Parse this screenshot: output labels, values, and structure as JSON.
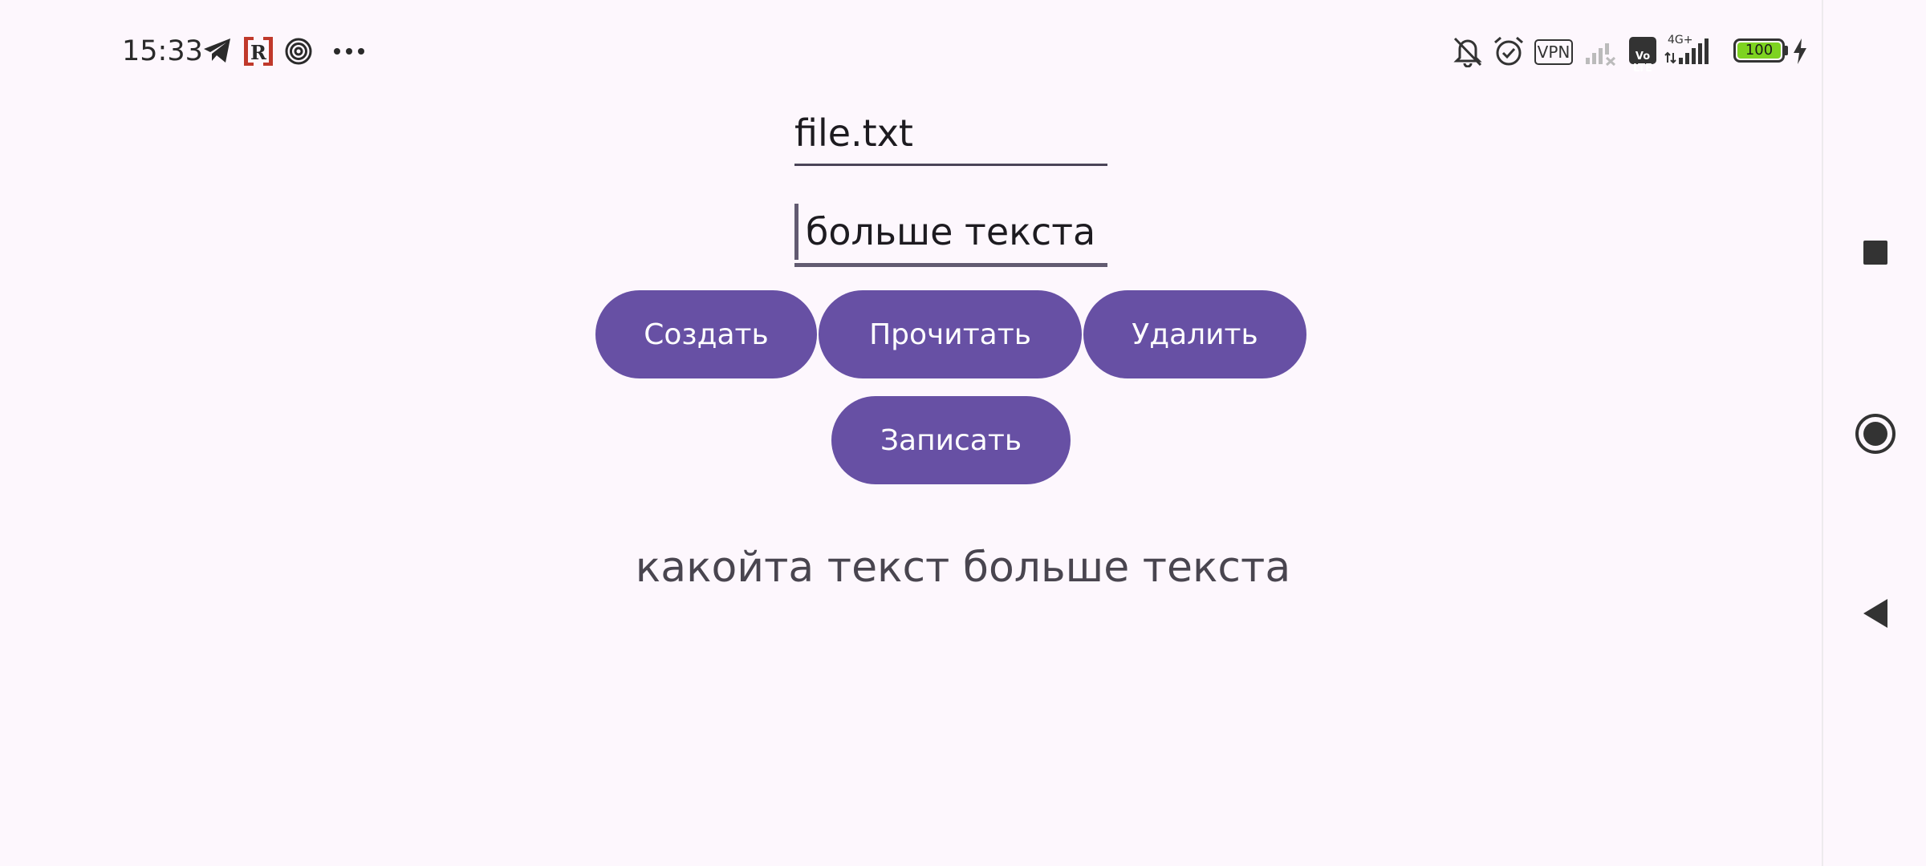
{
  "status_bar": {
    "time": "15:33",
    "vpn_label": "VPN",
    "volte_label": "Vo\nLTE",
    "network_type": "4G+",
    "battery_level": "100",
    "icons": [
      "telegram-icon",
      "app-r-icon",
      "spiral-icon",
      "more-dots-icon",
      "bell-muted-icon",
      "alarm-icon",
      "vpn-icon",
      "signal-sim1-icon",
      "volte-icon",
      "signal-sim2-icon",
      "battery-icon",
      "charging-icon"
    ]
  },
  "form": {
    "filename_value": "file.txt",
    "content_value": "больше текста"
  },
  "buttons": {
    "create": "Создать",
    "read": "Прочитать",
    "delete": "Удалить",
    "write": "Записать"
  },
  "output": {
    "text": "какойта текст больше текста"
  },
  "nav_bar": {
    "icons": [
      "recents-square-icon",
      "home-circle-icon",
      "back-triangle-icon"
    ]
  },
  "colors": {
    "background": "#fdf7fd",
    "primary": "#6750a4",
    "on_primary": "#ffffff",
    "text": "#1d1b20",
    "secondary_text": "#49454f",
    "battery_fill": "#7ed321"
  }
}
